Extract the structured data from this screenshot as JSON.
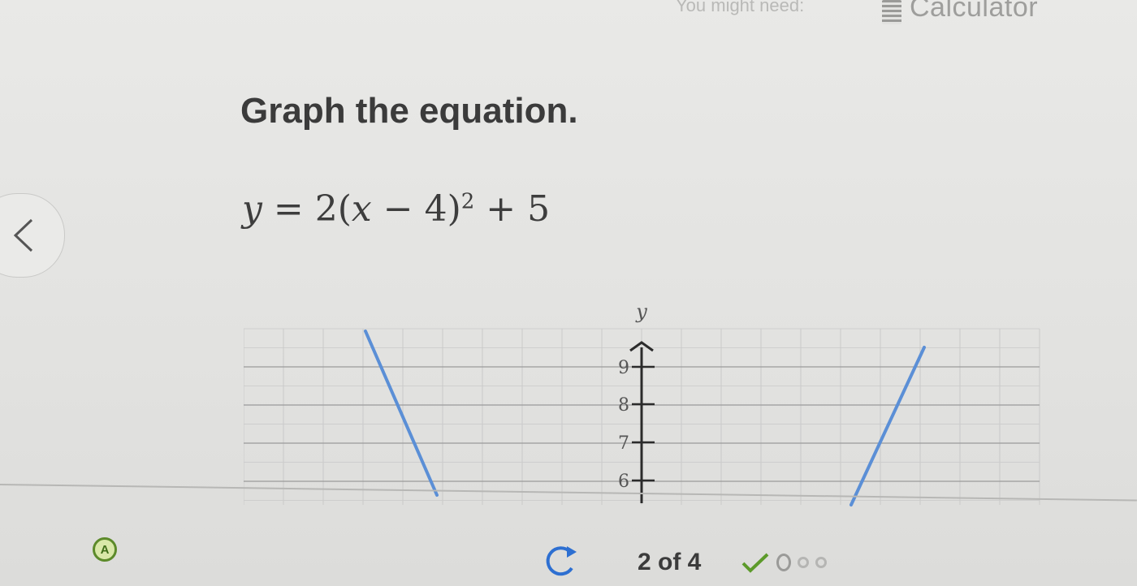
{
  "header": {
    "hint_text": "You might need:",
    "calculator_label": "Calculator",
    "calculator_icon": "calculator-icon"
  },
  "question": {
    "prompt": "Graph the equation.",
    "equation": {
      "lhs": "y",
      "equals": "=",
      "coef": "2(",
      "var": "x",
      "minus": " − 4)",
      "exponent": "2",
      "tail": " + 5"
    }
  },
  "navigation": {
    "prev_icon": "chevron-left-icon"
  },
  "graph": {
    "y_axis_label": "y",
    "y_tick_labels": [
      "9",
      "8",
      "7",
      "6"
    ],
    "curve_color": "#5b8fd6",
    "grid_color": "#c9c9c9",
    "major_grid_color": "#9a9a9a",
    "axis_color": "#2b2b2b"
  },
  "footer": {
    "hint_icon": "hint-icon",
    "hint_letter": "A",
    "retry_icon": "retry-icon",
    "progress_label": "2 of 4",
    "progress_icons": [
      "check-icon",
      "circle-icon",
      "circle-icon",
      "circle-icon"
    ],
    "check_color": "#5c9a2a"
  }
}
